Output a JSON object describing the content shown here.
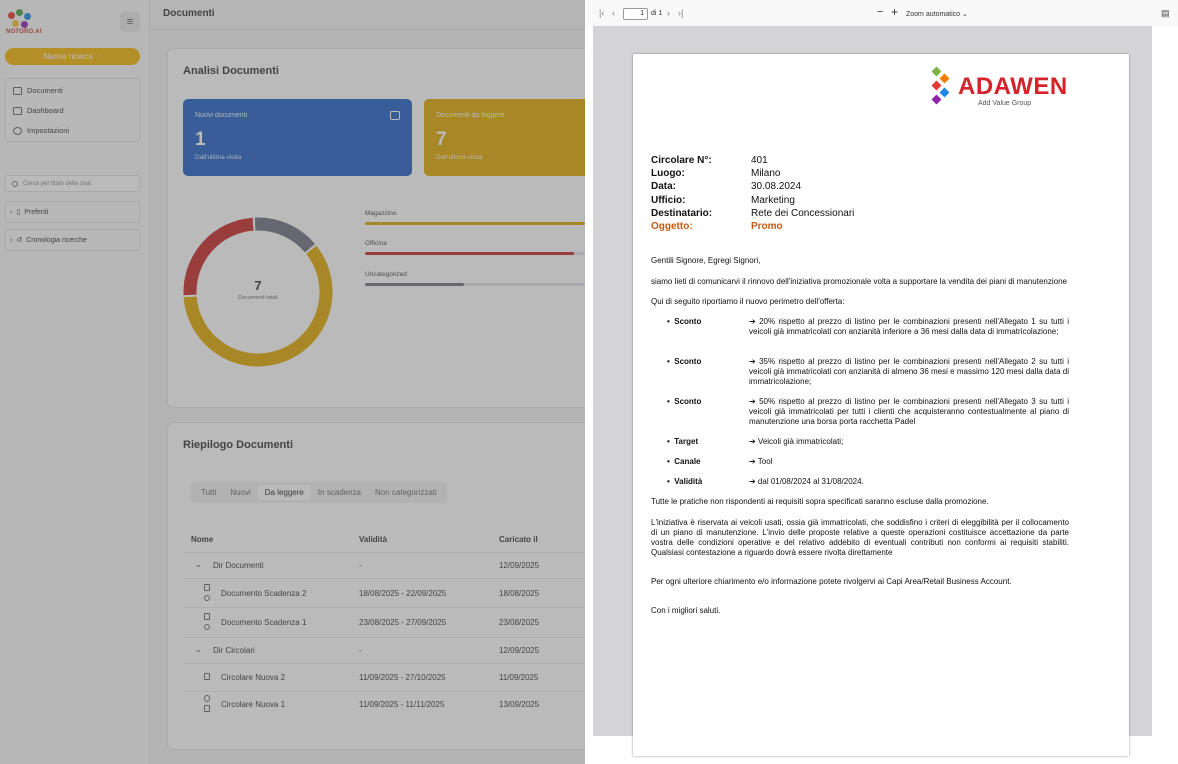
{
  "sidebar": {
    "logo_text": "NOTORO.AI",
    "new_search_label": "Nuova ricerca",
    "nav": [
      {
        "label": "Documenti"
      },
      {
        "label": "Dashboard"
      },
      {
        "label": "Impostazioni"
      }
    ],
    "search_placeholder": "Cerca per titolo della chat",
    "favorites_label": "Preferiti",
    "history_label": "Cronologia ricerche"
  },
  "main": {
    "header_title": "Documenti",
    "analysis_title": "Analisi Documenti",
    "cards": [
      {
        "label": "Nuovi documenti",
        "value": "1",
        "sub": "Dall'ultima visita",
        "color": "#1f5fc7"
      },
      {
        "label": "Documenti da leggere",
        "value": "7",
        "sub": "Dall'ultima visita",
        "color": "#e0a800"
      }
    ],
    "donut": {
      "total": "7",
      "caption": "Documenti totali"
    },
    "categories": [
      {
        "label": "Magazzino",
        "fraction": 1.0,
        "color": "#e0a800"
      },
      {
        "label": "Officina",
        "fraction": 0.95,
        "color": "#c62828"
      },
      {
        "label": "Uncategorized",
        "fraction": 0.45,
        "color": "#6e7180"
      }
    ],
    "summary_title": "Riepilogo Documenti",
    "tabs": [
      "Tutti",
      "Nuovi",
      "Da leggere",
      "In scadenza",
      "Non categorizzati"
    ],
    "active_tab": "Da leggere",
    "table_headers": [
      "Nome",
      "Validità",
      "Caricato il"
    ],
    "rows": [
      {
        "name": "Dir Documenti",
        "validity": "-",
        "uploaded": "12/09/2025"
      },
      {
        "name": "Documento Scadenza 2",
        "validity": "18/08/2025 - 22/09/2025",
        "uploaded": "18/08/2025"
      },
      {
        "name": "Documento Scadenza 1",
        "validity": "23/08/2025 - 27/09/2025",
        "uploaded": "23/08/2025"
      },
      {
        "name": "Dir Circolari",
        "validity": "-",
        "uploaded": "12/09/2025"
      },
      {
        "name": "Circolare Nuova 2",
        "validity": "11/09/2025 - 27/10/2025",
        "uploaded": "11/09/2025"
      },
      {
        "name": "Circolare Nuova 1",
        "validity": "11/09/2025 - 11/11/2025",
        "uploaded": "13/09/2025"
      }
    ]
  },
  "viewer": {
    "page_current": "1",
    "page_count": "di 1",
    "zoom": "Zoom automatico",
    "logo_word": "ADAWEN",
    "logo_sub": "Add Value Group",
    "meta": [
      {
        "k": "Circolare N°:",
        "v": "401"
      },
      {
        "k": "Luogo:",
        "v": "Milano"
      },
      {
        "k": "Data:",
        "v": "30.08.2024"
      },
      {
        "k": "Ufficio:",
        "v": "Marketing"
      },
      {
        "k": "Destinatario:",
        "v": "Rete dei Concessionari"
      },
      {
        "k": "Oggetto:",
        "v": "Promo"
      }
    ],
    "greeting": "Gentili Signore, Egregi Signori,",
    "intro": "siamo lieti di comunicarvi il rinnovo dell'iniziativa promozionale volta a supportare la vendita dei piani di manutenzione",
    "intro2": "Qui di seguito riportiamo il nuovo perimetro dell'offerta:",
    "bullets": [
      {
        "k": "Sconto",
        "v": "➔ 20% rispetto al prezzo di listino per le combinazioni presenti nell'Allegato 1 su tutti i veicoli già immatricolati con anzianità inferiore a 36 mesi dalla data di immatricolazione;"
      },
      {
        "k": "Sconto",
        "v": "➔ 35% rispetto al prezzo di listino per le combinazioni presenti nell'Allegato 2 su tutti i veicoli già immatricolati con anzianità di almeno 36 mesi e massimo 120 mesi dalla data di immatricolazione;"
      },
      {
        "k": "Sconto",
        "v": "➔ 50% rispetto al prezzo di listino per le combinazioni presenti nell'Allegato 3 su tutti i veicoli già immatricolati per tutti i clienti che acquisteranno contestualmente al piano di manutenzione una borsa porta racchetta Padel"
      },
      {
        "k": "Target",
        "v": "➔ Veicoli già immatricolati;"
      },
      {
        "k": "Canale",
        "v": "➔ Tool"
      },
      {
        "k": "Validità",
        "v": "➔ dal 01/08/2024 al 31/08/2024."
      }
    ],
    "p1": "Tutte le pratiche non rispondenti ai requisiti sopra specificati saranno escluse dalla promozione.",
    "p2": "L'iniziativa è riservata ai veicoli usati, ossia già immatricolati, che soddisfino i criteri di eleggibilità per il collocamento di un piano di manutenzione. L'invio delle proposte relative a queste operazioni costituisce accettazione da parte vostra delle condizioni operative e del relativo addebito di eventuali contributi non conformi ai requisiti stabiliti. Qualsiasi contestazione a riguardo dovrà essere rivolta direttamente",
    "p3": "Per ogni ulteriore chiarimento e/o informazione potete rivolgervi ai Capi Area/Retail Business Account.",
    "p4": "Con i migliori saluti."
  }
}
